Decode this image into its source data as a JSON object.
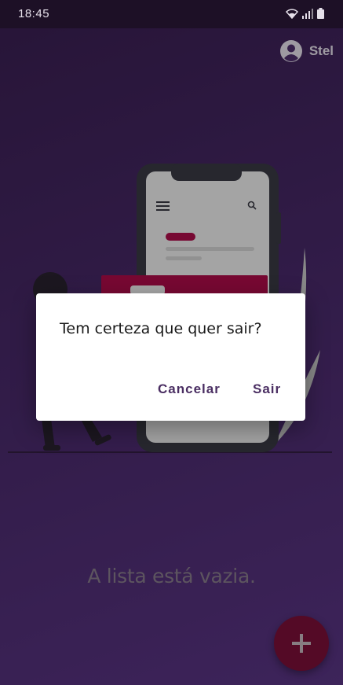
{
  "status_bar": {
    "time": "18:45",
    "icons": [
      "wifi-icon",
      "signal-icon",
      "battery-icon"
    ]
  },
  "header": {
    "user_name": "Stel",
    "user_icon": "account-circle-icon"
  },
  "main": {
    "empty_message": "A lista está vazia."
  },
  "fab": {
    "icon": "plus-icon"
  },
  "dialog": {
    "message": "Tem certeza que quer sair?",
    "cancel_label": "Cancelar",
    "confirm_label": "Sair"
  },
  "colors": {
    "background_top": "#3a1f52",
    "background_bottom": "#5a3585",
    "accent": "#7d0f38",
    "dialog_button_text": "#4a2e62"
  }
}
